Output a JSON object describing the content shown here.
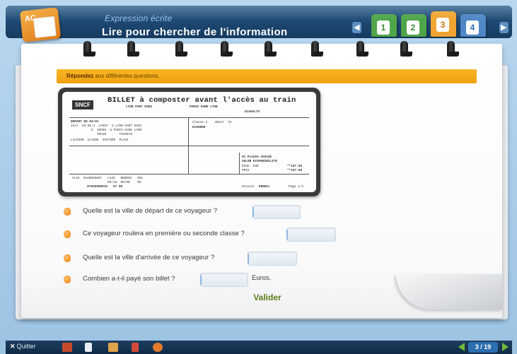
{
  "header": {
    "subtitle": "Expression écrite",
    "title": "Lire pour chercher de l'information",
    "logo_text": "AC",
    "tabs": [
      {
        "label": "1",
        "color": "#4fa64a"
      },
      {
        "label": "2",
        "color": "#4fa64a"
      },
      {
        "label": "3",
        "color": "#f0a431"
      },
      {
        "label": "4",
        "color": "#4f86c6"
      }
    ]
  },
  "instruction": {
    "bold": "Répondez",
    "rest": "aux différentes questions."
  },
  "ticket": {
    "logo": "SNCF",
    "title": "BILLET à composter avant l'accès au train",
    "col1": "LYON PART DIEU",
    "col2": "PARIS GARE LYON",
    "code": "D1A04L70",
    "depart_header": "DEPART DU 04/01",
    "line1": "1ère  26.09.1  17H57  à LYON PART DIEU",
    "line2": "           à  19H59  à PARIS GARE LYON",
    "line3": "              TRAIN       TGV6670",
    "line4": "LIAISON  CLASSE  VOITURE  PLACE",
    "classe": "Classe 2    ADULT  TG",
    "ref": "D1A08D8",
    "places": "01 PLACES ASSISE",
    "selon": "SELON DISPONIBILITE",
    "prix1_label": "ECHE  EUR",
    "prix1_val": "**107.90",
    "prix2_label": "PRIX",
    "prix2_val": "**107.90",
    "bottom1": "CLAS  6520586857   LAXO   BB0004   001",
    "bottom2": "                   09/19  RR/RR    00",
    "bottom3": "        87026008010   GT 90",
    "dossier_label": "Dossier",
    "dossier": "ER9DCL",
    "page": "Page 1/1"
  },
  "questions": [
    {
      "text": "Quelle est la ville de départ de ce voyageur ?",
      "answer": ""
    },
    {
      "text": "Ce voyageur roulera en première ou seconde classe ?",
      "answer": ""
    },
    {
      "text": "Quelle est la ville d'arrivée de ce voyageur ?",
      "answer": ""
    },
    {
      "text": "Combien a-t-il payé son billet ?",
      "answer": ""
    }
  ],
  "euros_label": "Euros.",
  "validate_label": "Valider",
  "toolbar": {
    "quit_label": "Quitter",
    "page_indicator": "3 / 19"
  }
}
